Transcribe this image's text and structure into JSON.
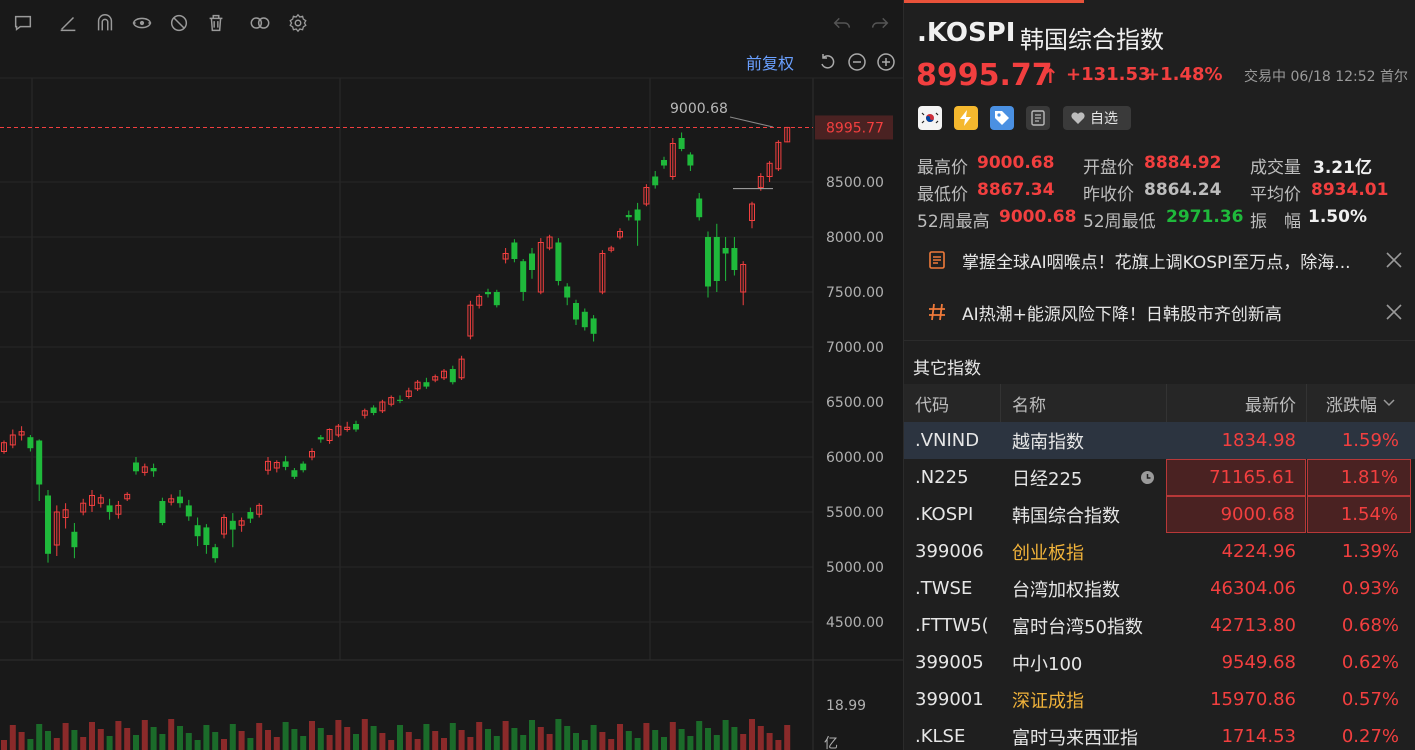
{
  "toolbar": {
    "icons": [
      "comment-icon",
      "draw-line-icon",
      "magnet-icon",
      "eye-icon",
      "hide-icon",
      "trash-icon",
      "toggle-icon",
      "settings-icon",
      "undo-icon",
      "redo-icon"
    ]
  },
  "chart": {
    "adjust_label": "前复权",
    "price_axis": [
      "8500.00",
      "8000.00",
      "7500.00",
      "7000.00",
      "6500.00",
      "6000.00",
      "5500.00",
      "5000.00",
      "4500.00"
    ],
    "current_price_tag": "8995.77",
    "peak_label": "9000.68",
    "volume_axis": "18.99",
    "volume_unit": "亿",
    "colors": {
      "up": "#f23f3f",
      "down": "#1fb93b",
      "tag_bg": "#4a2222"
    }
  },
  "quote": {
    "symbol": ".KOSPI",
    "name": "韩国综合指数",
    "last": "8995.77",
    "arrow": "↑",
    "change": "+131.53",
    "change_pct": "+1.48%",
    "status": "交易中 06/18 12:52 首尔",
    "fav_label": "自选",
    "badges": [
      "korea-flag-icon",
      "lightning-icon",
      "tag-icon",
      "document-icon"
    ]
  },
  "stats": {
    "high_label": "最高价",
    "high": "9000.68",
    "open_label": "开盘价",
    "open": "8884.92",
    "volume_label": "成交量",
    "volume": "3.21亿",
    "low_label": "最低价",
    "low": "8867.34",
    "prev_close_label": "昨收价",
    "prev_close": "8864.24",
    "avg_label": "平均价",
    "avg": "8934.01",
    "wk52_high_label": "52周最高",
    "wk52_high": "9000.68",
    "wk52_low_label": "52周最低",
    "wk52_low": "2971.36",
    "amplitude_label": "振　幅",
    "amplitude": "1.50%"
  },
  "news": [
    {
      "icon": "news-icon",
      "text": "掌握全球AI咽喉点！花旗上调KOSPI至万点，除海..."
    },
    {
      "icon": "hashtag-icon",
      "text": "AI热潮+能源风险下降！日韩股市齐创新高"
    }
  ],
  "other_indices": {
    "title": "其它指数",
    "headers": {
      "code": "代码",
      "name": "名称",
      "last": "最新价",
      "pct": "涨跌幅"
    },
    "rows": [
      {
        "code": ".VNIND",
        "name": "越南指数",
        "last": "1834.98",
        "pct": "1.59%"
      },
      {
        "code": ".N225",
        "name": "日经225",
        "last": "71165.61",
        "pct": "1.81%"
      },
      {
        "code": ".KOSPI",
        "name": "韩国综合指数",
        "last": "9000.68",
        "pct": "1.54%"
      },
      {
        "code": "399006",
        "name": "创业板指",
        "last": "4224.96",
        "pct": "1.39%"
      },
      {
        "code": ".TWSE",
        "name": "台湾加权指数",
        "last": "46304.06",
        "pct": "0.93%"
      },
      {
        "code": ".FTTW5(",
        "name": "富时台湾50指数",
        "last": "42713.80",
        "pct": "0.68%"
      },
      {
        "code": "399005",
        "name": "中小100",
        "last": "9549.68",
        "pct": "0.62%"
      },
      {
        "code": "399001",
        "name": "深证成指",
        "last": "15970.86",
        "pct": "0.57%"
      },
      {
        "code": ".KLSE",
        "name": "富时马来西亚指",
        "last": "1714.53",
        "pct": "0.27%"
      }
    ]
  }
}
